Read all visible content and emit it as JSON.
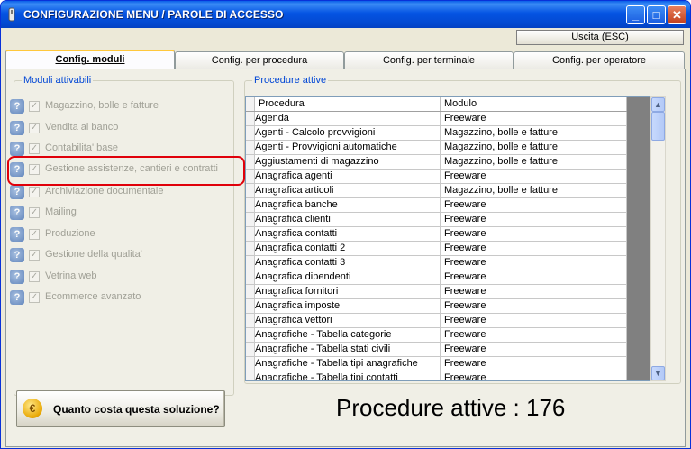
{
  "window": {
    "title": "CONFIGURAZIONE MENU / PAROLE DI ACCESSO"
  },
  "toolbar": {
    "exit_label": "Uscita (ESC)"
  },
  "tabs": [
    {
      "label": "Config. moduli",
      "active": true
    },
    {
      "label": "Config. per procedura",
      "active": false
    },
    {
      "label": "Config. per terminale",
      "active": false
    },
    {
      "label": "Config. per operatore",
      "active": false
    }
  ],
  "modules_panel": {
    "title": "Moduli attivabili",
    "items": [
      {
        "label": "Magazzino, bolle e fatture",
        "checked": true
      },
      {
        "label": "Vendita al banco",
        "checked": true
      },
      {
        "label": "Contabilita' base",
        "checked": true
      },
      {
        "label": "Gestione assistenze, cantieri e contratti",
        "checked": true
      },
      {
        "label": "Archiviazione documentale",
        "checked": true
      },
      {
        "label": "Mailing",
        "checked": true
      },
      {
        "label": "Produzione",
        "checked": true
      },
      {
        "label": "Gestione della qualita'",
        "checked": true
      },
      {
        "label": "Vetrina web",
        "checked": true
      },
      {
        "label": "Ecommerce avanzato",
        "checked": true
      }
    ],
    "cost_button": "Quanto costa questa soluzione?",
    "coin_symbol": "€"
  },
  "procedures_panel": {
    "title": "Procedure attive",
    "columns": [
      "Procedura",
      "Modulo"
    ],
    "rows": [
      [
        "Agenda",
        "Freeware"
      ],
      [
        "Agenti - Calcolo provvigioni",
        "Magazzino, bolle e fatture"
      ],
      [
        "Agenti - Provvigioni automatiche",
        "Magazzino, bolle e fatture"
      ],
      [
        "Aggiustamenti di magazzino",
        "Magazzino, bolle e fatture"
      ],
      [
        "Anagrafica agenti",
        "Freeware"
      ],
      [
        "Anagrafica articoli",
        "Magazzino, bolle e fatture"
      ],
      [
        "Anagrafica banche",
        "Freeware"
      ],
      [
        "Anagrafica clienti",
        "Freeware"
      ],
      [
        "Anagrafica contatti",
        "Freeware"
      ],
      [
        "Anagrafica contatti 2",
        "Freeware"
      ],
      [
        "Anagrafica contatti 3",
        "Freeware"
      ],
      [
        "Anagrafica dipendenti",
        "Freeware"
      ],
      [
        "Anagrafica fornitori",
        "Freeware"
      ],
      [
        "Anagrafica imposte",
        "Freeware"
      ],
      [
        "Anagrafica vettori",
        "Freeware"
      ],
      [
        "Anagrafiche - Tabella categorie",
        "Freeware"
      ],
      [
        "Anagrafiche - Tabella stati civili",
        "Freeware"
      ],
      [
        "Anagrafiche - Tabella tipi anagrafiche",
        "Freeware"
      ],
      [
        "Anagrafiche - Tabella tipi contatti",
        "Freeware"
      ]
    ],
    "summary": "Procedure attive : 176"
  }
}
